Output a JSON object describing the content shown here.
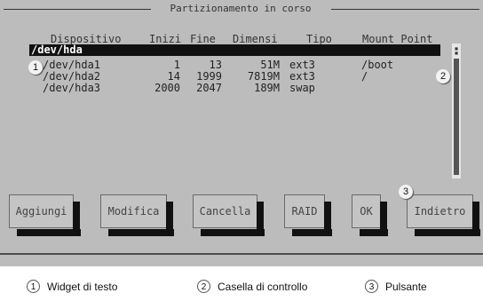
{
  "window": {
    "title": "Partizionamento in corso"
  },
  "columns": [
    "Dispositivo",
    "Inizi",
    "Fine",
    "Dimensi",
    "Tipo",
    "Mount Point"
  ],
  "device": "/dev/hda",
  "partitions": [
    {
      "device": "/dev/hda1",
      "start": "1",
      "end": "13",
      "size": "51M",
      "type": "ext3",
      "mount": "/boot"
    },
    {
      "device": "/dev/hda2",
      "start": "14",
      "end": "1999",
      "size": "7819M",
      "type": "ext3",
      "mount": "/"
    },
    {
      "device": "/dev/hda3",
      "start": "2000",
      "end": "2047",
      "size": "189M",
      "type": "swap",
      "mount": ""
    }
  ],
  "buttons": {
    "add": "Aggiungi",
    "edit": "Modifica",
    "delete": "Cancella",
    "raid": "RAID",
    "ok": "OK",
    "back": "Indietro"
  },
  "callouts": [
    "1",
    "2",
    "3"
  ],
  "legend": [
    {
      "num": "1",
      "text": "Widget di testo"
    },
    {
      "num": "2",
      "text": "Casella di controllo"
    },
    {
      "num": "3",
      "text": "Pulsante"
    }
  ],
  "colors": {
    "screen": "#bcbcbc",
    "selection": "#111111",
    "shadow": "#111111"
  }
}
